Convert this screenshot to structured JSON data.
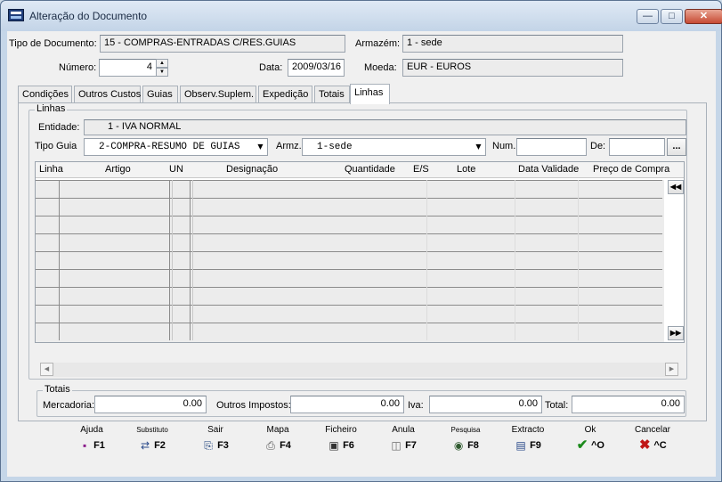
{
  "window": {
    "title": "Alteração do Documento"
  },
  "header": {
    "tipo_documento_label": "Tipo de Documento:",
    "tipo_documento_value": "15 - COMPRAS-ENTRADAS C/RES.GUIAS",
    "armazem_label": "Armazém:",
    "armazem_value": "1 - sede",
    "numero_label": "Número:",
    "numero_value": "4",
    "data_label": "Data:",
    "data_value": "2009/03/16",
    "moeda_label": "Moeda:",
    "moeda_value": "EUR - EUROS"
  },
  "tabs": [
    "Condições",
    "Outros Custos",
    "Guias",
    "Observ.Suplem.",
    "Expedição",
    "Totais",
    "Linhas"
  ],
  "active_tab": "Linhas",
  "linhas": {
    "group_label": "Linhas",
    "entidade_label": "Entidade:",
    "entidade_value": "1 - IVA NORMAL",
    "tipo_guia_label": "Tipo Guia",
    "tipo_guia_value": "2-COMPRA-RESUMO DE GUIAS",
    "armz_label": "Armz.",
    "armz_value": "1-sede",
    "num_label": "Num.",
    "num_value": "",
    "de_label": "De:",
    "de_value": "",
    "dots_label": "...",
    "columns": [
      "Linha",
      "Artigo",
      "UN",
      "Designação",
      "Quantidade",
      "E/S",
      "Lote",
      "Data Validade",
      "Preço de Compra"
    ]
  },
  "totais": {
    "group_label": "Totais",
    "mercadoria_label": "Mercadoria:",
    "mercadoria_value": "0.00",
    "outros_impostos_label": "Outros Impostos:",
    "outros_impostos_value": "0.00",
    "iva_label": "Iva:",
    "iva_value": "0.00",
    "total_label": "Total:",
    "total_value": "0.00"
  },
  "fkeys": [
    {
      "label": "Ajuda",
      "key": "F1",
      "icon": "book-icon"
    },
    {
      "label": "Substituto",
      "key": "F2",
      "icon": "replace-icon"
    },
    {
      "label": "Sair",
      "key": "F3",
      "icon": "exit-door-icon"
    },
    {
      "label": "Mapa",
      "key": "F4",
      "icon": "printer-icon"
    },
    {
      "label": "Ficheiro",
      "key": "F6",
      "icon": "save-disk-icon"
    },
    {
      "label": "Anula",
      "key": "F7",
      "icon": "trash-icon"
    },
    {
      "label": "Pesquisa",
      "key": "F8",
      "icon": "binoculars-icon"
    },
    {
      "label": "Extracto",
      "key": "F9",
      "icon": "document-icon"
    },
    {
      "label": "Ok",
      "key": "^O",
      "icon": "checkmark-icon"
    },
    {
      "label": "Cancelar",
      "key": "^C",
      "icon": "cross-icon"
    }
  ],
  "colors": {
    "ok": "#1c8a1c",
    "cancel": "#c01818",
    "window_frame": "#c5d6e8"
  }
}
